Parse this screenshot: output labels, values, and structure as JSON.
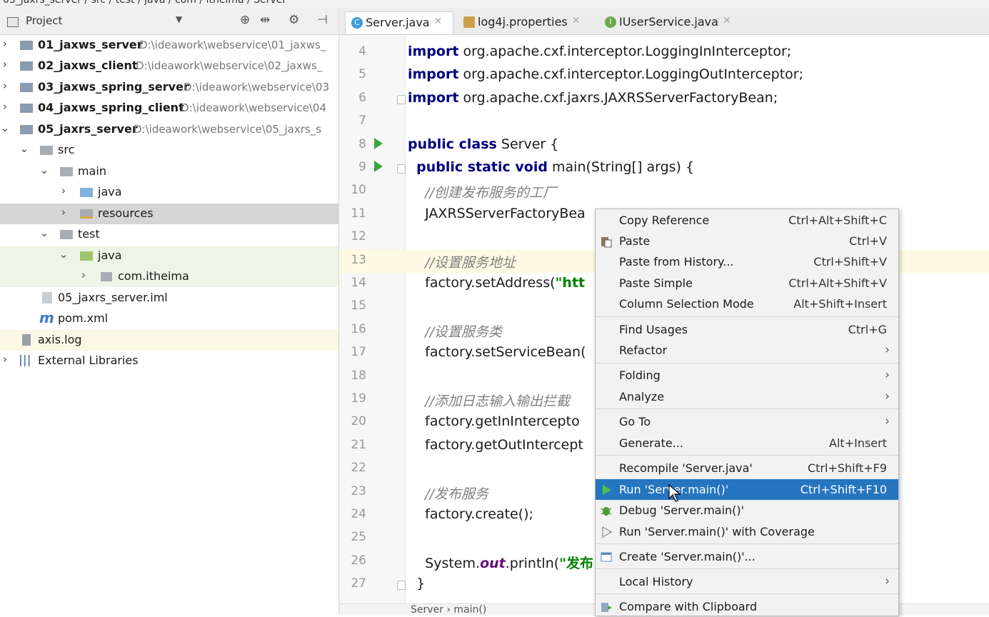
{
  "breadcrumb": {
    "text": "05_jaxrs_server / src / test / java / com / itheima / Server"
  },
  "project": {
    "title": "Project",
    "toolbar": {
      "locate_icon": "target-icon",
      "collapse_icon": "collapse-icon",
      "settings_icon": "gear-icon",
      "hide_icon": "hide-panel-icon"
    },
    "tree": [
      {
        "label": "01_jaxws_server",
        "path": "D:\\ideawork\\webservice\\01_jaxws_"
      },
      {
        "label": "02_jaxws_client",
        "path": "D:\\ideawork\\webservice\\02_jaxws_"
      },
      {
        "label": "03_jaxws_spring_server",
        "path": "D:\\ideawork\\webservice\\03"
      },
      {
        "label": "04_jaxws_spring_client",
        "path": "D:\\ideawork\\webservice\\04"
      },
      {
        "label": "05_jaxrs_server",
        "path": "D:\\ideawork\\webservice\\05_jaxrs_s"
      },
      {
        "label": "src"
      },
      {
        "label": "main"
      },
      {
        "label": "java"
      },
      {
        "label": "resources"
      },
      {
        "label": "test"
      },
      {
        "label": "java"
      },
      {
        "label": "com.itheima"
      },
      {
        "label": "05_jaxrs_server.iml"
      },
      {
        "label": "pom.xml"
      },
      {
        "label": "axis.log"
      },
      {
        "label": "External Libraries"
      }
    ]
  },
  "tabs": [
    {
      "label": "Server.java",
      "icon": "C"
    },
    {
      "label": "log4j.properties",
      "icon": "chart"
    },
    {
      "label": "IUserService.java",
      "icon": "I"
    }
  ],
  "editor": {
    "lines": [
      {
        "n": "4",
        "parts": [
          [
            "kw",
            "import"
          ],
          [
            "",
            " org.apache.cxf.interceptor.LoggingInInterceptor;"
          ]
        ]
      },
      {
        "n": "5",
        "parts": [
          [
            "kw",
            "import"
          ],
          [
            "",
            " org.apache.cxf.interceptor.LoggingOutInterceptor;"
          ]
        ]
      },
      {
        "n": "6",
        "parts": [
          [
            "kw",
            "import"
          ],
          [
            "",
            " org.apache.cxf.jaxrs.JAXRSServerFactoryBean;"
          ]
        ]
      },
      {
        "n": "7",
        "parts": []
      },
      {
        "n": "8",
        "parts": [
          [
            "kw",
            "public class"
          ],
          [
            "",
            " Server {"
          ]
        ]
      },
      {
        "n": "9",
        "parts": [
          [
            "",
            "  "
          ],
          [
            "kw",
            "public static void"
          ],
          [
            "",
            " main(String[] args) {"
          ]
        ]
      },
      {
        "n": "10",
        "parts": [
          [
            "",
            "    "
          ],
          [
            "cm",
            "//创建发布服务的工厂"
          ]
        ]
      },
      {
        "n": "11",
        "parts": [
          [
            "",
            "    JAXRSServerFactoryBea"
          ]
        ]
      },
      {
        "n": "12",
        "parts": []
      },
      {
        "n": "13",
        "parts": [
          [
            "",
            "    "
          ],
          [
            "cm",
            "//设置服务地址"
          ]
        ]
      },
      {
        "n": "14",
        "parts": [
          [
            "",
            "    factory.setAddress("
          ],
          [
            "str",
            "\"htt"
          ]
        ]
      },
      {
        "n": "15",
        "parts": []
      },
      {
        "n": "16",
        "parts": [
          [
            "",
            "    "
          ],
          [
            "cm",
            "//设置服务类"
          ]
        ]
      },
      {
        "n": "17",
        "parts": [
          [
            "",
            "    factory.setServiceBean("
          ]
        ]
      },
      {
        "n": "18",
        "parts": []
      },
      {
        "n": "19",
        "parts": [
          [
            "",
            "    "
          ],
          [
            "cm",
            "//添加日志输入输出拦截"
          ]
        ]
      },
      {
        "n": "20",
        "parts": [
          [
            "",
            "    factory.getInIntercepto"
          ]
        ]
      },
      {
        "n": "21",
        "parts": [
          [
            "",
            "    factory.getOutIntercept"
          ]
        ]
      },
      {
        "n": "22",
        "parts": []
      },
      {
        "n": "23",
        "parts": [
          [
            "",
            "    "
          ],
          [
            "cm",
            "//发布服务"
          ]
        ]
      },
      {
        "n": "24",
        "parts": [
          [
            "",
            "    factory.create();"
          ]
        ]
      },
      {
        "n": "25",
        "parts": []
      },
      {
        "n": "26",
        "parts": [
          [
            "",
            "    System."
          ],
          [
            "fld",
            "out"
          ],
          [
            "",
            ".println("
          ],
          [
            "str",
            "\"发布"
          ]
        ]
      },
      {
        "n": "27",
        "parts": [
          [
            "",
            "  }"
          ]
        ]
      }
    ]
  },
  "status_bar": {
    "text": "Server  ›  main()"
  },
  "context_menu": {
    "items": [
      {
        "label": "Copy Reference",
        "shortcut": "Ctrl+Alt+Shift+C"
      },
      {
        "label": "Paste",
        "shortcut": "Ctrl+V",
        "icon": "paste-icon"
      },
      {
        "label": "Paste from History...",
        "shortcut": "Ctrl+Shift+V"
      },
      {
        "label": "Paste Simple",
        "shortcut": "Ctrl+Alt+Shift+V"
      },
      {
        "label": "Column Selection Mode",
        "shortcut": "Alt+Shift+Insert"
      },
      {
        "label": "Find Usages",
        "shortcut": "Ctrl+G"
      },
      {
        "label": "Refactor",
        "submenu": true
      },
      {
        "label": "Folding",
        "submenu": true
      },
      {
        "label": "Analyze",
        "submenu": true
      },
      {
        "label": "Go To",
        "submenu": true
      },
      {
        "label": "Generate...",
        "shortcut": "Alt+Insert"
      },
      {
        "label": "Recompile 'Server.java'",
        "shortcut": "Ctrl+Shift+F9"
      },
      {
        "label": "Run 'Server.main()'",
        "shortcut": "Ctrl+Shift+F10",
        "icon": "run-icon"
      },
      {
        "label": "Debug 'Server.main()'",
        "icon": "debug-icon"
      },
      {
        "label": "Run 'Server.main()' with Coverage",
        "icon": "coverage-icon"
      },
      {
        "label": "Create 'Server.main()'...",
        "icon": "create-config-icon"
      },
      {
        "label": "Local History",
        "submenu": true
      },
      {
        "label": "Compare with Clipboard",
        "icon": "compare-icon"
      }
    ]
  },
  "colors": {
    "accent": "#2675bf",
    "keyword": "#000080",
    "comment": "#808080",
    "string": "#008000",
    "run_green": "#3aa53a"
  }
}
